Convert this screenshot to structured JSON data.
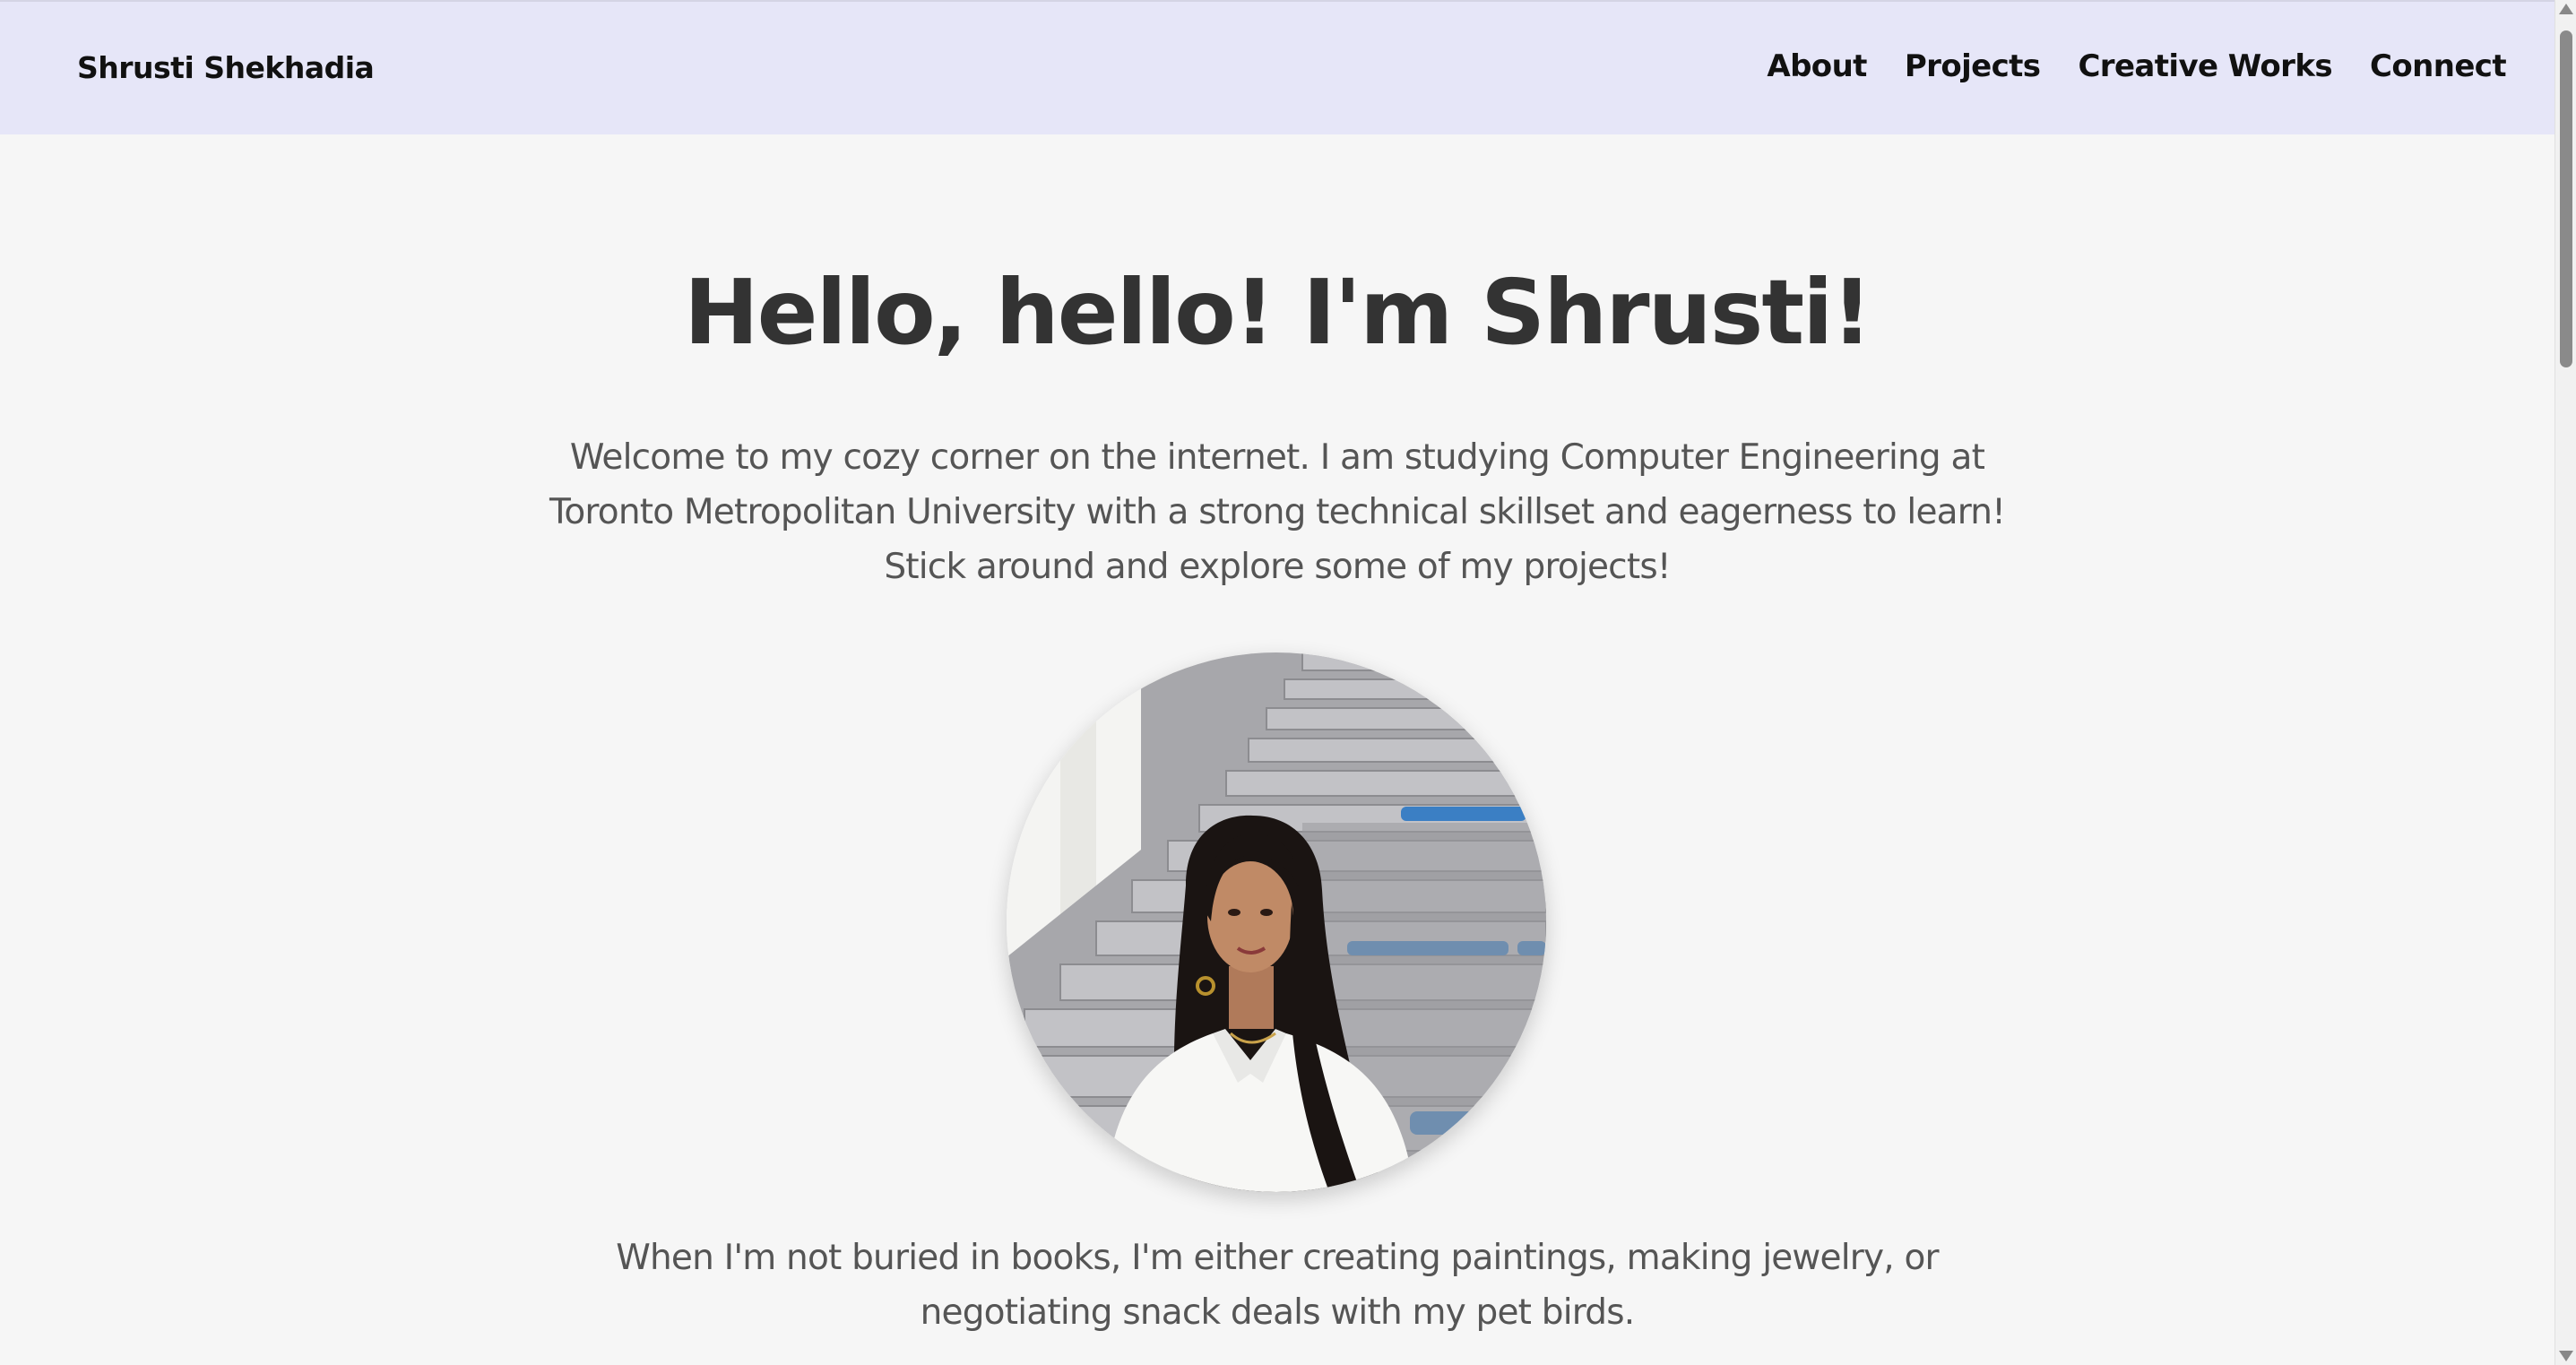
{
  "navbar": {
    "brand": "Shrusti Shekhadia",
    "links": [
      {
        "label": "About"
      },
      {
        "label": "Projects"
      },
      {
        "label": "Creative Works"
      },
      {
        "label": "Connect"
      }
    ],
    "background_color": "#e6e6f8"
  },
  "hero": {
    "title": "Hello, hello! I'm Shrusti!",
    "intro_lines": [
      "Welcome to my cozy corner on the internet. I am studying Computer Engineering at",
      "Toronto Metropolitan University with a strong technical skillset and eagerness to learn!",
      "Stick around and explore some of my projects!"
    ],
    "outro_lines": [
      "When I'm not buried in books, I'm either creating paintings, making jewelry, or",
      "negotiating snack deals with my pet birds."
    ]
  },
  "portrait": {
    "icon": "profile-photo"
  },
  "colors": {
    "page_bg": "#f6f6f6",
    "title": "#333333",
    "body_text": "#555555"
  }
}
